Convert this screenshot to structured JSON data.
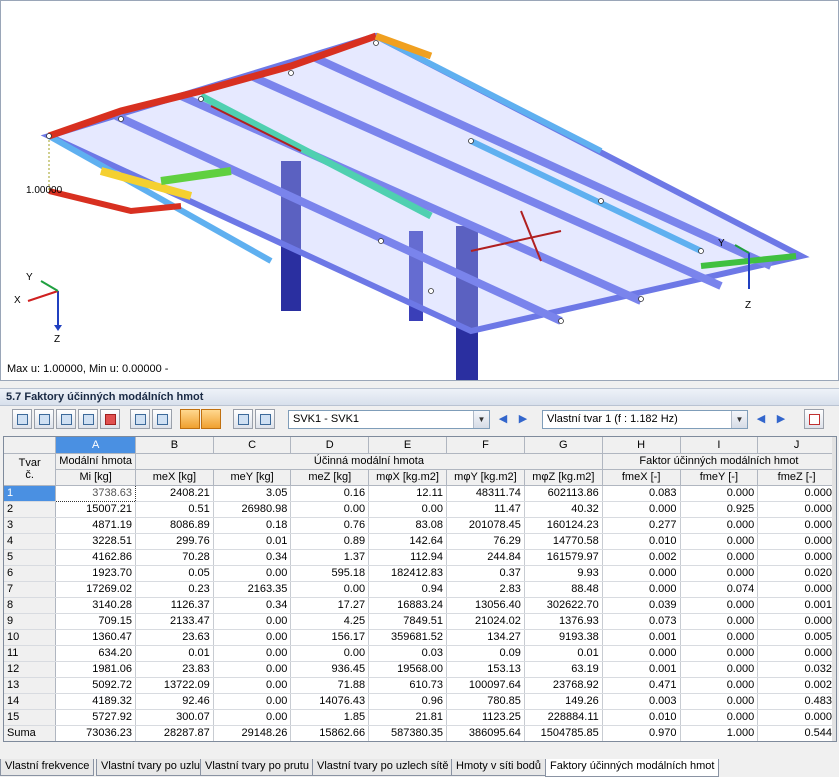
{
  "viewport": {
    "status": "Max u: 1.00000, Min u: 0.00000 -",
    "deformation_label": "1.00000",
    "axes_left": {
      "x": "X",
      "y": "Y",
      "z": "Z"
    },
    "axes_right": {
      "y": "Y",
      "z": "Z"
    }
  },
  "panel": {
    "title": "5.7 Faktory účinných modálních hmot",
    "load_case": "SVK1 - SVK1",
    "mode_shape": "Vlastní tvar 1 (f : 1.182 Hz)",
    "prev_label": "◀",
    "next_label": "▶"
  },
  "table": {
    "col_letters": [
      "A",
      "B",
      "C",
      "D",
      "E",
      "F",
      "G",
      "H",
      "I",
      "J"
    ],
    "row_header_top": "Tvar",
    "row_header_bottom": "č.",
    "group_a": "Modální hmota",
    "group_effective": "Účinná modální hmota",
    "group_factor": "Faktor účinných modálních hmot",
    "col_units": [
      "Mi [kg]",
      "meX [kg]",
      "meY [kg]",
      "meZ [kg]",
      "mφX [kg.m2]",
      "mφY [kg.m2]",
      "mφZ [kg.m2]",
      "fmeX [-]",
      "fmeY [-]",
      "fmeZ [-]"
    ],
    "rows": [
      [
        "1",
        "3738.63",
        "2408.21",
        "3.05",
        "0.16",
        "12.11",
        "48311.74",
        "602113.86",
        "0.083",
        "0.000",
        "0.000"
      ],
      [
        "2",
        "15007.21",
        "0.51",
        "26980.98",
        "0.00",
        "0.00",
        "11.47",
        "40.32",
        "0.000",
        "0.925",
        "0.000"
      ],
      [
        "3",
        "4871.19",
        "8086.89",
        "0.18",
        "0.76",
        "83.08",
        "201078.45",
        "160124.23",
        "0.277",
        "0.000",
        "0.000"
      ],
      [
        "4",
        "3228.51",
        "299.76",
        "0.01",
        "0.89",
        "142.64",
        "76.29",
        "14770.58",
        "0.010",
        "0.000",
        "0.000"
      ],
      [
        "5",
        "4162.86",
        "70.28",
        "0.34",
        "1.37",
        "112.94",
        "244.84",
        "161579.97",
        "0.002",
        "0.000",
        "0.000"
      ],
      [
        "6",
        "1923.70",
        "0.05",
        "0.00",
        "595.18",
        "182412.83",
        "0.37",
        "9.93",
        "0.000",
        "0.000",
        "0.020"
      ],
      [
        "7",
        "17269.02",
        "0.23",
        "2163.35",
        "0.00",
        "0.94",
        "2.83",
        "88.48",
        "0.000",
        "0.074",
        "0.000"
      ],
      [
        "8",
        "3140.28",
        "1126.37",
        "0.34",
        "17.27",
        "16883.24",
        "13056.40",
        "302622.70",
        "0.039",
        "0.000",
        "0.001"
      ],
      [
        "9",
        "709.15",
        "2133.47",
        "0.00",
        "4.25",
        "7849.51",
        "21024.02",
        "1376.93",
        "0.073",
        "0.000",
        "0.000"
      ],
      [
        "10",
        "1360.47",
        "23.63",
        "0.00",
        "156.17",
        "359681.52",
        "134.27",
        "9193.38",
        "0.001",
        "0.000",
        "0.005"
      ],
      [
        "11",
        "634.20",
        "0.01",
        "0.00",
        "0.00",
        "0.03",
        "0.09",
        "0.01",
        "0.000",
        "0.000",
        "0.000"
      ],
      [
        "12",
        "1981.06",
        "23.83",
        "0.00",
        "936.45",
        "19568.00",
        "153.13",
        "63.19",
        "0.001",
        "0.000",
        "0.032"
      ],
      [
        "13",
        "5092.72",
        "13722.09",
        "0.00",
        "71.88",
        "610.73",
        "100097.64",
        "23768.92",
        "0.471",
        "0.000",
        "0.002"
      ],
      [
        "14",
        "4189.32",
        "92.46",
        "0.00",
        "14076.43",
        "0.96",
        "780.85",
        "149.26",
        "0.003",
        "0.000",
        "0.483"
      ],
      [
        "15",
        "5727.92",
        "300.07",
        "0.00",
        "1.85",
        "21.81",
        "1123.25",
        "228884.11",
        "0.010",
        "0.000",
        "0.000"
      ],
      [
        "Suma",
        "73036.23",
        "28287.87",
        "29148.26",
        "15862.66",
        "587380.35",
        "386095.64",
        "1504785.85",
        "0.970",
        "1.000",
        "0.544"
      ]
    ]
  },
  "tabs": [
    "Vlastní frekvence",
    "Vlastní tvary po uzlu",
    "Vlastní tvary po prutu",
    "Vlastní tvary po uzlech sítě",
    "Hmoty v síti bodů",
    "Faktory účinných modálních hmot"
  ],
  "colors": {
    "selection": "#4a90e2",
    "frame_blue": "#4f5bd8",
    "deform_red": "#d02020"
  }
}
